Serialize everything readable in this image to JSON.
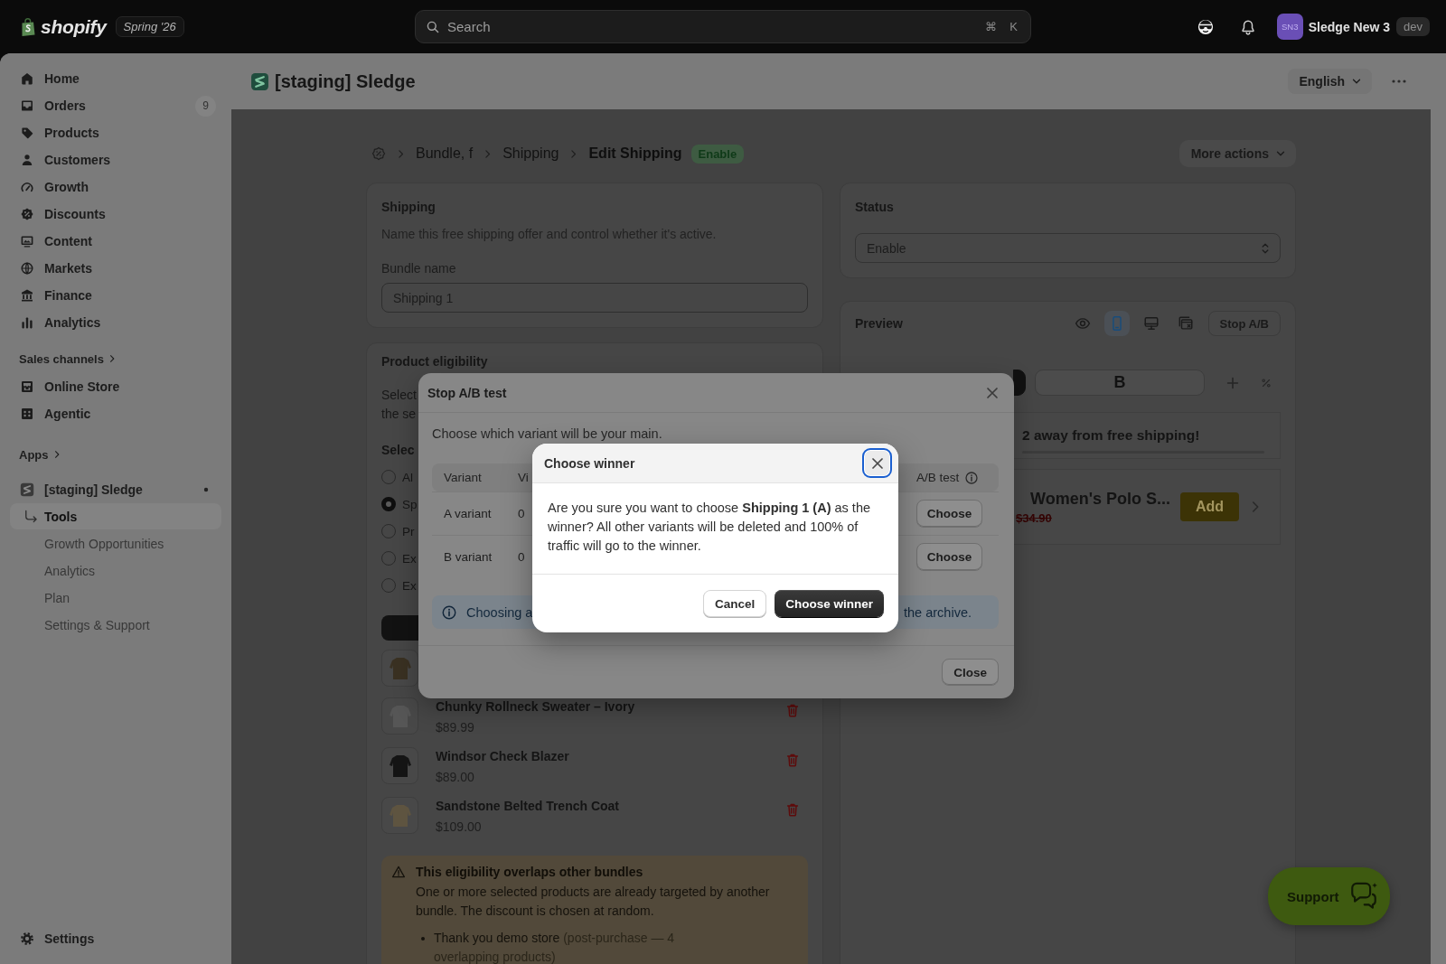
{
  "topbar": {
    "logo": "shopify",
    "edition": "Spring '26",
    "search": {
      "placeholder": "Search",
      "shortcut": [
        "⌘",
        "K"
      ]
    },
    "store": {
      "avatar": "SN3",
      "name": "Sledge New 3",
      "badge": "dev"
    }
  },
  "sidebar": {
    "main": [
      {
        "label": "Home",
        "selected": false
      },
      {
        "label": "Orders",
        "badge": "9",
        "selected": false
      },
      {
        "label": "Products",
        "selected": false
      },
      {
        "label": "Customers",
        "selected": false
      },
      {
        "label": "Growth",
        "selected": false
      },
      {
        "label": "Discounts",
        "selected": false
      },
      {
        "label": "Content",
        "selected": false
      },
      {
        "label": "Markets",
        "selected": false
      },
      {
        "label": "Finance",
        "selected": false
      },
      {
        "label": "Analytics",
        "selected": false
      }
    ],
    "sales_channels": {
      "heading": "Sales channels",
      "items": [
        {
          "label": "Online Store",
          "selected": false
        },
        {
          "label": "Agentic",
          "selected": false
        }
      ]
    },
    "apps": {
      "heading": "Apps"
    },
    "app": {
      "label": "[staging] Sledge",
      "selected": false,
      "children": [
        {
          "label": "Tools",
          "selected": true
        },
        {
          "label": "Growth Opportunities",
          "selected": false
        },
        {
          "label": "Analytics",
          "selected": false
        },
        {
          "label": "Plan",
          "selected": false
        },
        {
          "label": "Settings & Support",
          "selected": false
        }
      ]
    },
    "settings": {
      "label": "Settings",
      "selected": false
    }
  },
  "header": {
    "app_title": "[staging] Sledge",
    "language": "English"
  },
  "breadcrumb": {
    "items": [
      "Bundle, f",
      "Shipping"
    ],
    "current": "Edit Shipping",
    "status_badge": "Enable",
    "more_actions": "More actions"
  },
  "shipping_card": {
    "title": "Shipping",
    "description": "Name this free shipping offer and control whether it's active.",
    "field_label": "Bundle name",
    "field_value": "Shipping 1"
  },
  "eligibility_card": {
    "title": "Product eligibility",
    "description_lines": [
      "Select",
      "the se"
    ],
    "subheading": "Selec",
    "options": [
      {
        "label": "Al",
        "selected": false
      },
      {
        "label": "Sp",
        "selected": true
      },
      {
        "label": "Pr",
        "selected": false
      },
      {
        "label": "Ex",
        "selected": false
      },
      {
        "label": "Ex",
        "selected": false
      }
    ],
    "products": [
      {
        "name": "Chunky Rollneck Sweater – Ivory",
        "price": "$89.99"
      },
      {
        "name": "Windsor Check Blazer",
        "price": "$89.00"
      },
      {
        "name": "Sandstone Belted Trench Coat",
        "price": "$109.00"
      }
    ],
    "warning": {
      "title": "This eligibility overlaps other bundles",
      "body": "One or more selected products are already targeted by another bundle. The discount is chosen at random.",
      "bullets": [
        {
          "store": "Thank you demo store",
          "detail": "(post-purchase — 4 overlapping products)"
        }
      ]
    }
  },
  "status_card": {
    "title": "Status",
    "value": "Enable"
  },
  "preview_card": {
    "title": "Preview",
    "modes": [
      {
        "selected": false
      },
      {
        "selected": true
      },
      {
        "selected": false
      },
      {
        "selected": false
      }
    ],
    "stop_button": "Stop A/B",
    "variant_tabs": [
      {
        "selected": true
      },
      {
        "label": "B",
        "selected": false
      }
    ],
    "banner": "2 away from free shipping!",
    "product": {
      "name": "Women's Polo S...",
      "compare_price": "$34.90",
      "add_button": "Add"
    }
  },
  "stop_ab_modal": {
    "title": "Stop A/B test",
    "intro": "Choose which variant will be your main.",
    "columns": [
      "Variant",
      "Vi",
      "A/B test"
    ],
    "rows": [
      {
        "variant": "A variant",
        "column_2": "0",
        "action": "Choose"
      },
      {
        "variant": "B variant",
        "column_2": "0",
        "action": "Choose"
      }
    ],
    "info_start": "Choosing a",
    "info_end": "the archive.",
    "close": "Close"
  },
  "confirm_modal": {
    "title": "Choose winner",
    "message": "Are you sure you want to choose **Shipping 1 (A)** as the winner? All other variants will be deleted and 100% of traffic will go to the winner.",
    "cancel": "Cancel",
    "confirm": "Choose winner"
  },
  "support_button": {
    "label": "Support"
  }
}
